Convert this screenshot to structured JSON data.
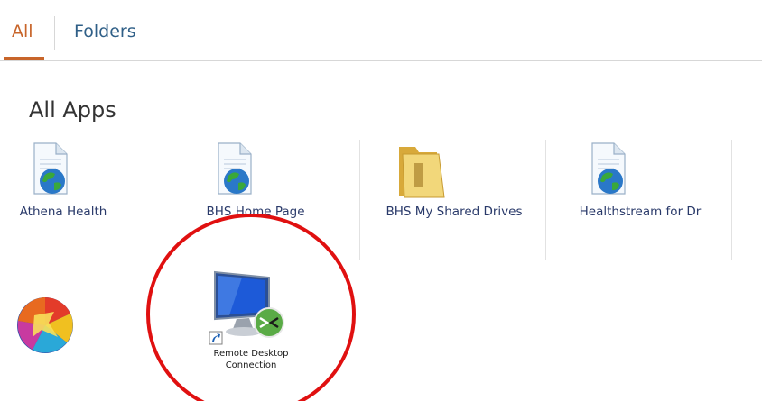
{
  "tabs": {
    "all_label": "All",
    "folders_label": "Folders"
  },
  "section": {
    "title": "All Apps"
  },
  "apps_row1": [
    {
      "label": "Athena Health",
      "icon": "web-shortcut-icon"
    },
    {
      "label": "BHS Home Page",
      "icon": "web-shortcut-icon"
    },
    {
      "label": "BHS My Shared Drives",
      "icon": "folder-icon"
    },
    {
      "label": "Healthstream for Dr",
      "icon": "web-shortcut-icon"
    }
  ],
  "apps_row2": [
    {
      "label": "",
      "icon": "colorful-app-icon"
    },
    {
      "label_line1": "Remote Desktop",
      "label_line2": "Connection",
      "icon": "remote-desktop-icon"
    }
  ],
  "colors": {
    "accent": "#c8652a",
    "link": "#2f5f87",
    "annotation": "#e01010"
  }
}
